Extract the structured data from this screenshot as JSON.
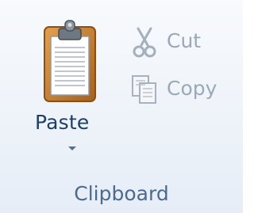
{
  "clipboard_group": {
    "label": "Clipboard",
    "paste": {
      "label": "Paste",
      "icon": "clipboard-paste-icon",
      "dropdown_icon": "chevron-down-icon"
    },
    "cut": {
      "label": "Cut",
      "icon": "scissors-icon",
      "state": "disabled"
    },
    "copy": {
      "label": "Copy",
      "icon": "copy-icon",
      "state": "disabled"
    }
  },
  "colors": {
    "paste_text": "#1e3f66",
    "disabled_text": "#9aa8b8",
    "group_label": "#4d6a8b",
    "clipboard_brown": "#c07a2e",
    "background": "#eef3f9"
  }
}
